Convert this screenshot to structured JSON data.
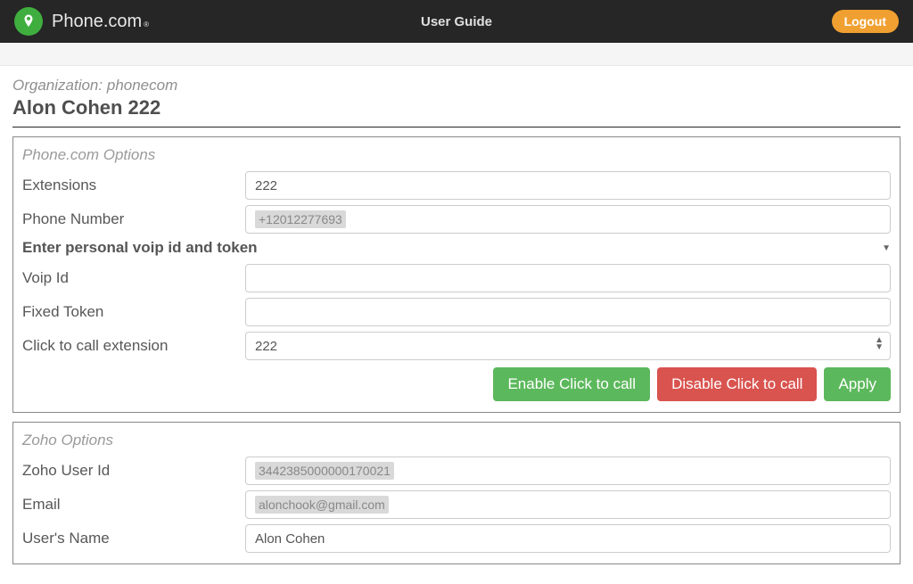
{
  "topbar": {
    "brand": "Phone.com",
    "centerLink": "User Guide",
    "logoutLabel": "Logout"
  },
  "header": {
    "orgLabel": "Organization:",
    "orgName": "phonecom",
    "title": "Alon Cohen 222"
  },
  "phoneOptions": {
    "legend": "Phone.com Options",
    "extensionsLabel": "Extensions",
    "extensionsValue": "222",
    "phoneNumberLabel": "Phone Number",
    "phoneNumberRedacted": "+12012277693",
    "voipHeader": "Enter personal voip id and token",
    "voipIdLabel": "Voip Id",
    "voipIdValue": "",
    "fixedTokenLabel": "Fixed Token",
    "fixedTokenValue": "",
    "clickToCallLabel": "Click to call extension",
    "clickToCallValue": "222",
    "buttons": {
      "enable": "Enable Click to call",
      "disable": "Disable Click to call",
      "apply": "Apply"
    }
  },
  "zohoOptions": {
    "legend": "Zoho Options",
    "userIdLabel": "Zoho User Id",
    "userIdRedacted": "3442385000000170021",
    "emailLabel": "Email",
    "emailRedacted": "alonchook@gmail.com",
    "nameLabel": "User's Name",
    "nameValue": "Alon Cohen"
  }
}
